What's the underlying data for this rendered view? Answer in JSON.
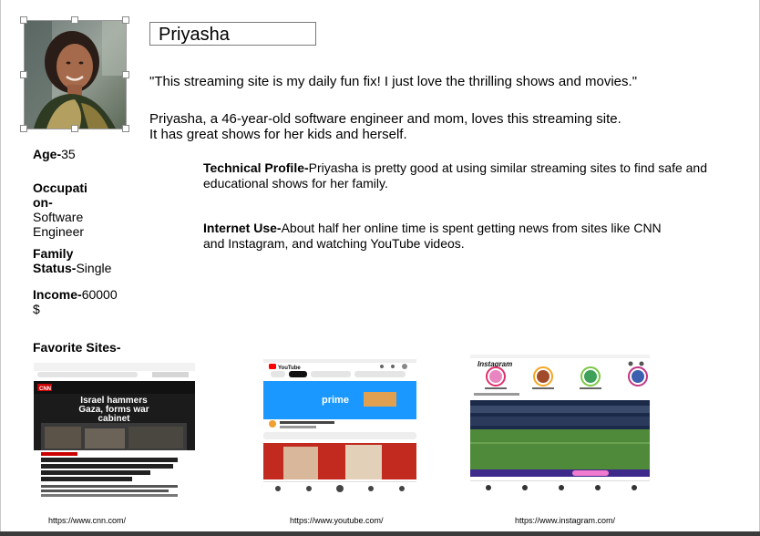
{
  "persona": {
    "name": "Priyasha",
    "quote": "\"This streaming site is my daily fun fix! I just love the thrilling shows and movies.\"",
    "bio_line1": "Priyasha, a 46-year-old software engineer and mom, loves this streaming site.",
    "bio_line2": "It has great shows for her kids and herself."
  },
  "details": {
    "age_label": "Age-",
    "age_value": "35",
    "occupation_label_1": "Occupati",
    "occupation_label_2": "on-",
    "occupation_value_1": "Software",
    "occupation_value_2": "Engineer",
    "family_label_1": "Family",
    "family_label_2": "Status-",
    "family_value": "Single",
    "income_label": "Income-",
    "income_value": "60000",
    "income_unit": "$"
  },
  "profile": {
    "technical_label": "Technical Profile-",
    "technical_text": "Priyasha is pretty good at using similar streaming sites to find safe and educational shows for her family.",
    "internet_label": "Internet Use-",
    "internet_text_1": "About half her online time is spent getting news from sites like CNN",
    "internet_text_2": "and Instagram, and watching YouTube videos."
  },
  "favorites": {
    "title": "Favorite Sites-",
    "sites": [
      {
        "url": "https://www.cnn.com/",
        "headline_1": "Israel hammers",
        "headline_2": "Gaza, forms war",
        "headline_3": "cabinet",
        "logo": "CNN"
      },
      {
        "url": "https://www.youtube.com/",
        "brand": "YouTube",
        "promo": "prime"
      },
      {
        "url": "https://www.instagram.com/",
        "brand": "Instagram"
      }
    ]
  },
  "colors": {
    "cnn_red": "#cc0000",
    "youtube_red": "#ff0000",
    "prime_blue": "#1a98ff",
    "pitch_green": "#4f8a3a"
  }
}
